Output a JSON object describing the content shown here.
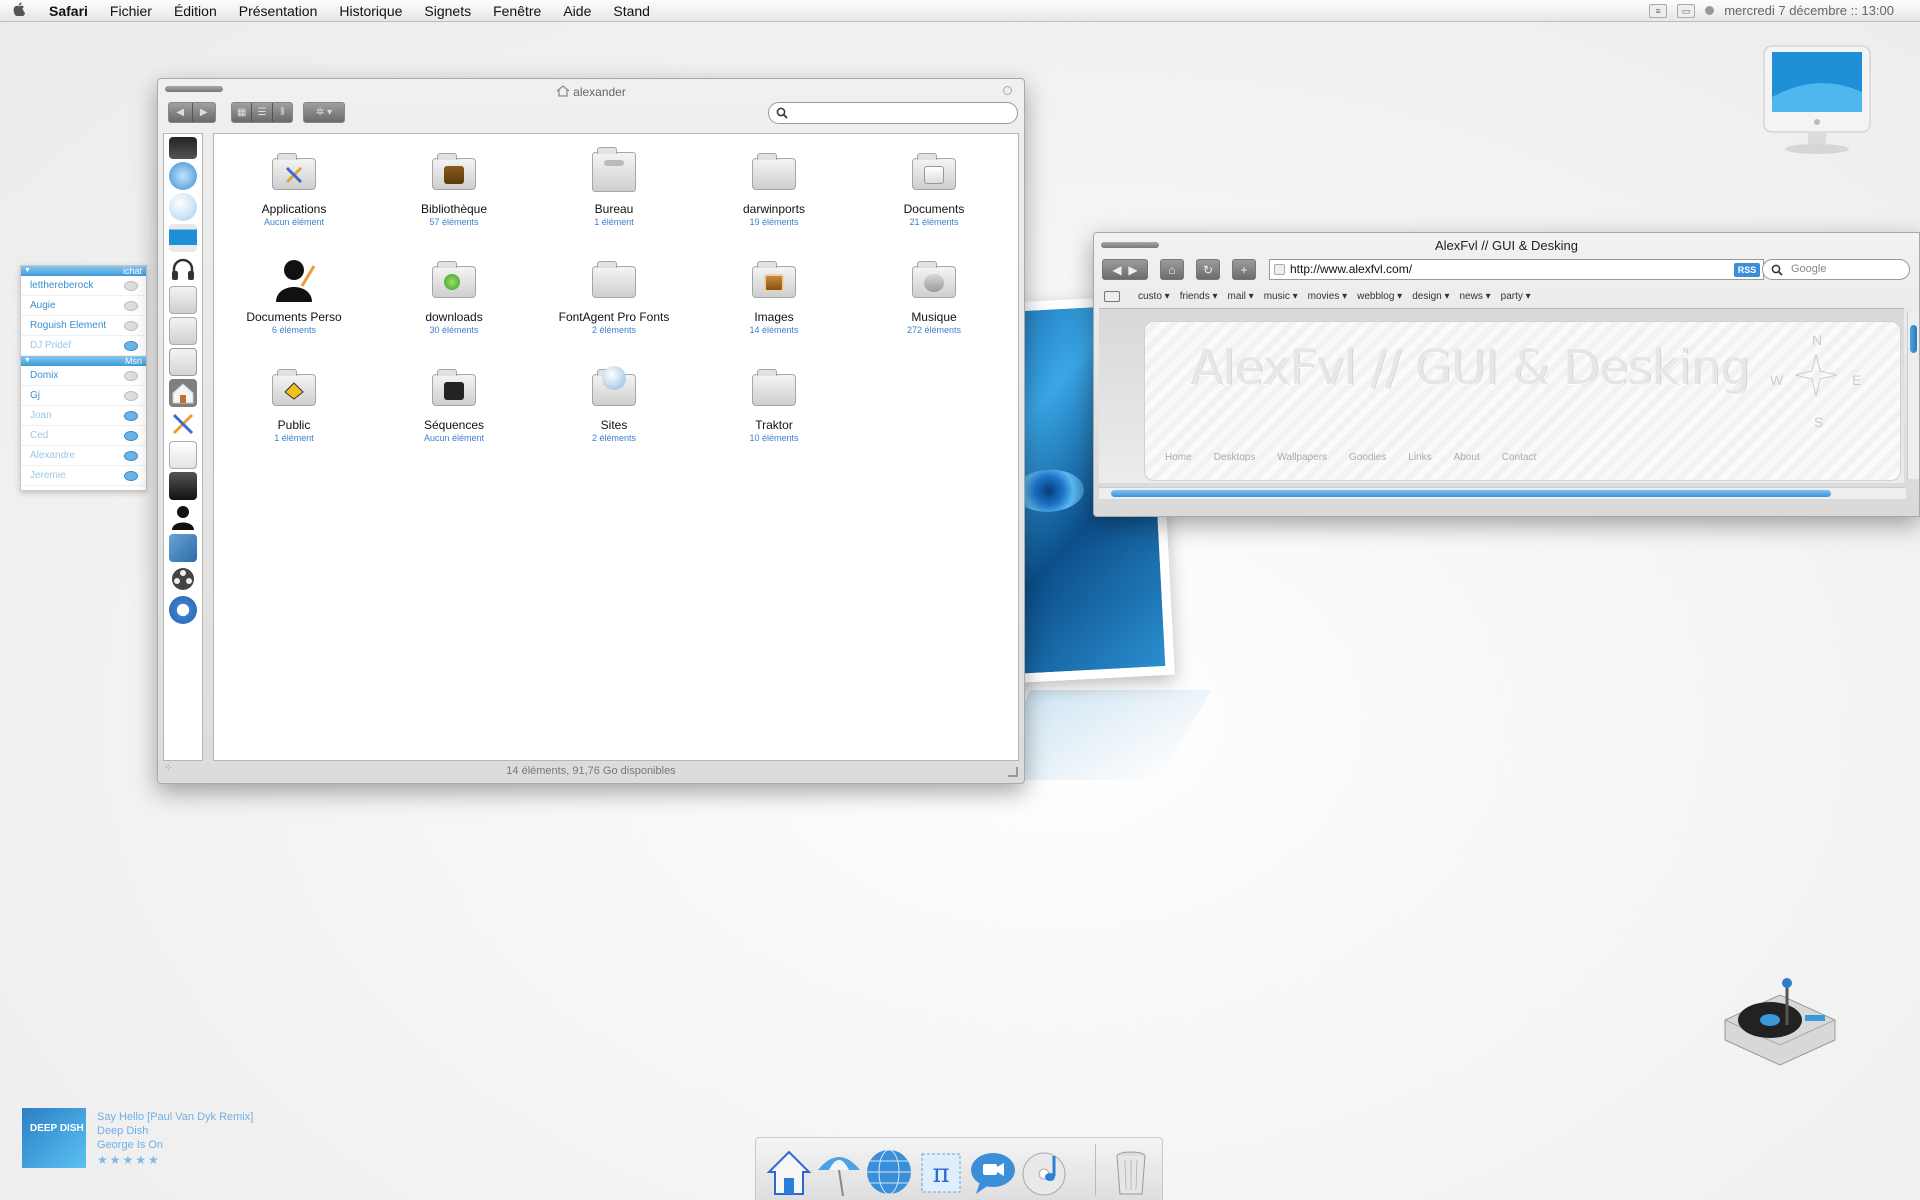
{
  "menubar": {
    "apple": "",
    "app_name": "Safari",
    "menus": [
      "Fichier",
      "Édition",
      "Présentation",
      "Historique",
      "Signets",
      "Fenêtre",
      "Aide",
      "Stand"
    ],
    "clock": "mercredi 7 décembre :: 13:00"
  },
  "buddy_list": {
    "groups": [
      {
        "name": "ichat",
        "buddies": [
          {
            "name": "letthereberock",
            "active": true
          },
          {
            "name": "Augie",
            "active": true
          },
          {
            "name": "Roguish Element",
            "active": true
          },
          {
            "name": "DJ Pridef",
            "active": false
          }
        ]
      },
      {
        "name": "Msn",
        "buddies": [
          {
            "name": "Domix",
            "active": true
          },
          {
            "name": "Gj",
            "active": true
          },
          {
            "name": "Joan",
            "active": false
          },
          {
            "name": "Ced",
            "active": false
          },
          {
            "name": "Alexandre",
            "active": false
          },
          {
            "name": "Jeremie",
            "active": false
          }
        ]
      }
    ]
  },
  "finder": {
    "title": "alexander",
    "search_placeholder": "",
    "status": "14 éléments, 91,76 Go disponibles",
    "items": [
      {
        "name": "Applications",
        "count": "Aucun élément",
        "icon": "applications-folder-icon"
      },
      {
        "name": "Bibliothèque",
        "count": "57 éléments",
        "icon": "library-folder-icon"
      },
      {
        "name": "Bureau",
        "count": "1 élément",
        "icon": "desktop-folder-icon"
      },
      {
        "name": "darwinports",
        "count": "19 éléments",
        "icon": "folder-icon"
      },
      {
        "name": "Documents",
        "count": "21 éléments",
        "icon": "documents-folder-icon"
      },
      {
        "name": "Documents Perso",
        "count": "6 éléments",
        "icon": "user-silhouette-icon"
      },
      {
        "name": "downloads",
        "count": "30 éléments",
        "icon": "downloads-folder-icon"
      },
      {
        "name": "FontAgent Pro Fonts",
        "count": "2 éléments",
        "icon": "folder-icon"
      },
      {
        "name": "Images",
        "count": "14 éléments",
        "icon": "pictures-folder-icon"
      },
      {
        "name": "Musique",
        "count": "272 éléments",
        "icon": "music-folder-icon"
      },
      {
        "name": "Public",
        "count": "1 élément",
        "icon": "public-folder-icon"
      },
      {
        "name": "Séquences",
        "count": "Aucun élément",
        "icon": "movies-folder-icon"
      },
      {
        "name": "Sites",
        "count": "2 éléments",
        "icon": "sites-folder-icon"
      },
      {
        "name": "Traktor",
        "count": "10 éléments",
        "icon": "folder-icon"
      }
    ],
    "sidebar_icons": [
      "monitor-icon",
      "network-icon",
      "globe-icon",
      "imac-icon",
      "headphones-icon",
      "usb-drive-icon",
      "usb-drive-icon",
      "desktop-icon",
      "home-icon",
      "applications-icon",
      "documents-icon",
      "city-icon",
      "user-icon",
      "pictures-icon",
      "film-reel-icon",
      "ipod-icon"
    ]
  },
  "safari": {
    "title": "AlexFvl // GUI & Desking",
    "url": "http://www.alexfvl.com/",
    "rss": "RSS",
    "search_placeholder": "Google",
    "bookmarks": [
      "custo",
      "friends",
      "mail",
      "music",
      "movies",
      "webblog",
      "design",
      "news",
      "party"
    ],
    "page": {
      "logo": "AlexFvl // GUI & Desking",
      "nav": [
        "Home",
        "Desktops",
        "Wallpapers",
        "Goodies",
        "Links",
        "About",
        "Contact"
      ],
      "compass": [
        "N",
        "W",
        "E",
        "S"
      ]
    }
  },
  "now_playing": {
    "art_text": "DEEP DISH",
    "track": "Say Hello [Paul Van Dyk Remix]",
    "artist": "Deep Dish",
    "album": "George Is On",
    "rating": "★★★★★"
  },
  "dock": [
    "home-icon",
    "beach-umbrella-icon",
    "safari-globe-icon",
    "pi-stamp-icon",
    "ichat-bubble-icon",
    "itunes-cd-icon",
    "trash-icon"
  ],
  "colors": {
    "accent": "#3b8fd0",
    "rss": "#3a8fd8"
  }
}
